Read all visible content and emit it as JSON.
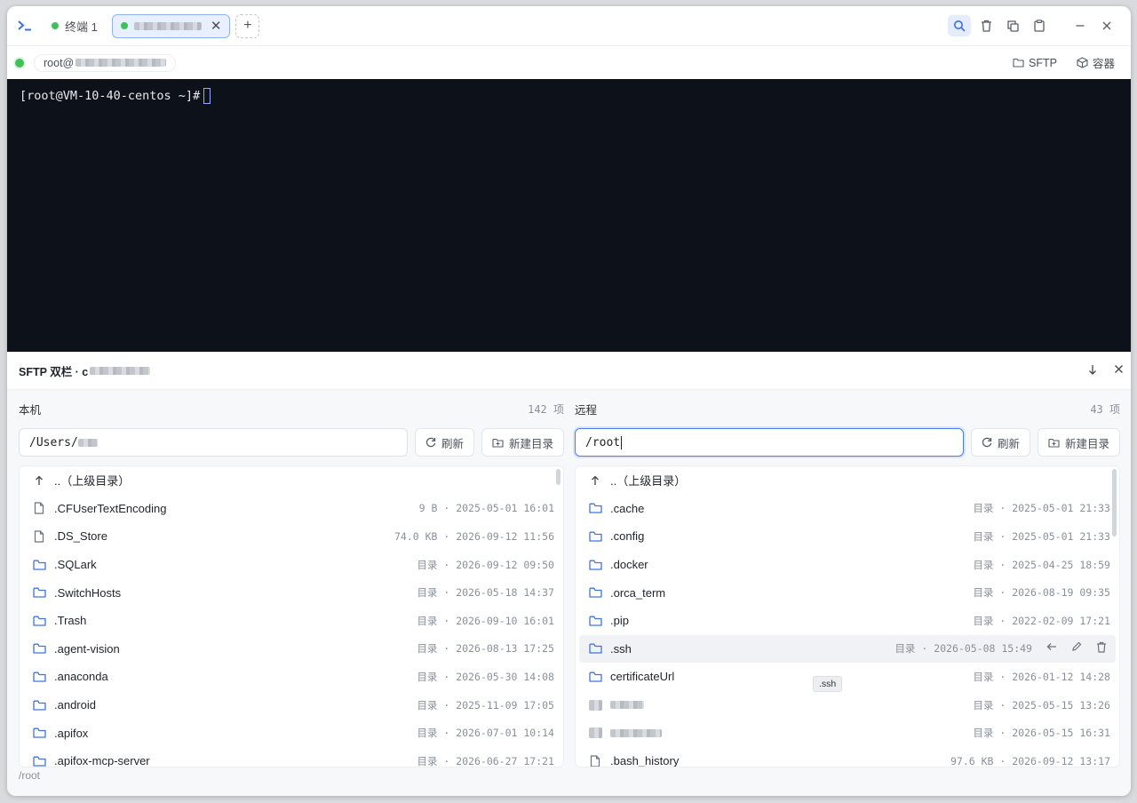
{
  "titlebar": {
    "tab1_label": "终端 1",
    "add_tab": "+"
  },
  "session": {
    "host_prefix": "root@",
    "sftp_label": "SFTP",
    "container_label": "容器"
  },
  "terminal": {
    "prompt": "[root@VM-10-40-centos ~]#"
  },
  "sftp": {
    "title": "SFTP 双栏 · c",
    "local": {
      "label": "本机",
      "count": "142 项",
      "path": "/Users/",
      "refresh": "刷新",
      "new_dir": "新建目录",
      "parent": "..（上级目录）",
      "rows": [
        {
          "name": ".CFUserTextEncoding",
          "type": "file",
          "meta": "9 B · 2025-05-01 16:01"
        },
        {
          "name": ".DS_Store",
          "type": "file",
          "meta": "74.0 KB · 2026-09-12 11:56"
        },
        {
          "name": ".SQLark",
          "type": "dir",
          "meta": "目录 · 2026-09-12 09:50"
        },
        {
          "name": ".SwitchHosts",
          "type": "dir",
          "meta": "目录 · 2026-05-18 14:37"
        },
        {
          "name": ".Trash",
          "type": "dir",
          "meta": "目录 · 2026-09-10 16:01"
        },
        {
          "name": ".agent-vision",
          "type": "dir",
          "meta": "目录 · 2026-08-13 17:25"
        },
        {
          "name": ".anaconda",
          "type": "dir",
          "meta": "目录 · 2026-05-30 14:08"
        },
        {
          "name": ".android",
          "type": "dir",
          "meta": "目录 · 2025-11-09 17:05"
        },
        {
          "name": ".apifox",
          "type": "dir",
          "meta": "目录 · 2026-07-01 10:14"
        },
        {
          "name": ".apifox-mcp-server",
          "type": "dir",
          "meta": "目录 · 2026-06-27 17:21"
        }
      ]
    },
    "remote": {
      "label": "远程",
      "count": "43 项",
      "path": "/root",
      "refresh": "刷新",
      "new_dir": "新建目录",
      "parent": "..（上级目录）",
      "rows": [
        {
          "name": ".cache",
          "type": "dir",
          "meta": "目录 · 2025-05-01 21:33"
        },
        {
          "name": ".config",
          "type": "dir",
          "meta": "目录 · 2025-05-01 21:33"
        },
        {
          "name": ".docker",
          "type": "dir",
          "meta": "目录 · 2025-04-25 18:59"
        },
        {
          "name": ".orca_term",
          "type": "dir",
          "meta": "目录 · 2026-08-19 09:35"
        },
        {
          "name": ".pip",
          "type": "dir",
          "meta": "目录 · 2022-02-09 17:21"
        },
        {
          "name": ".ssh",
          "type": "dir",
          "meta": "目录 · 2026-05-08 15:49"
        },
        {
          "name": "certificateUrl",
          "type": "dir",
          "meta": "目录 · 2026-01-12 14:28"
        },
        {
          "name": "",
          "type": "dir-blur",
          "meta": "目录 · 2025-05-15 13:26"
        },
        {
          "name": "",
          "type": "dir-blur",
          "meta": "目录 · 2026-05-15 16:31"
        },
        {
          "name": ".bash_history",
          "type": "file",
          "meta": "97.6 KB · 2026-09-12 13:17"
        }
      ],
      "tooltip": ".ssh"
    },
    "status_path": "/root"
  }
}
